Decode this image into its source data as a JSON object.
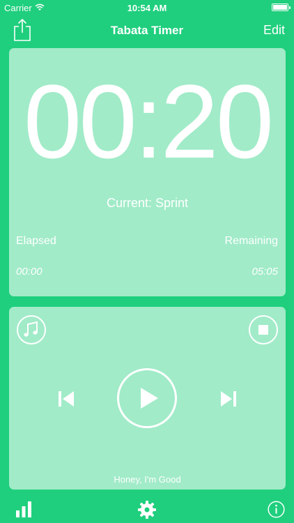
{
  "status_bar": {
    "carrier": "Carrier",
    "time": "10:54 AM",
    "wifi_icon": "wifi-icon",
    "battery_icon": "battery-icon"
  },
  "nav": {
    "title": "Tabata Timer",
    "edit_label": "Edit",
    "share_icon": "share-icon"
  },
  "timer": {
    "time": "00:20",
    "current": "Current: Sprint",
    "elapsed_label": "Elapsed",
    "remaining_label": "Remaining",
    "elapsed_value": "00:00",
    "remaining_value": "05:05"
  },
  "player": {
    "song": "Honey, I'm Good",
    "music_icon": "music-note-icon",
    "stop_icon": "stop-icon",
    "prev_icon": "skip-previous-icon",
    "play_icon": "play-icon",
    "next_icon": "skip-next-icon"
  },
  "tabbar": {
    "stats_icon": "bar-chart-icon",
    "settings_icon": "gear-icon",
    "info_icon": "info-icon"
  },
  "colors": {
    "background": "#1fcf7d",
    "card": "#a3edc9",
    "foreground": "#ffffff"
  }
}
